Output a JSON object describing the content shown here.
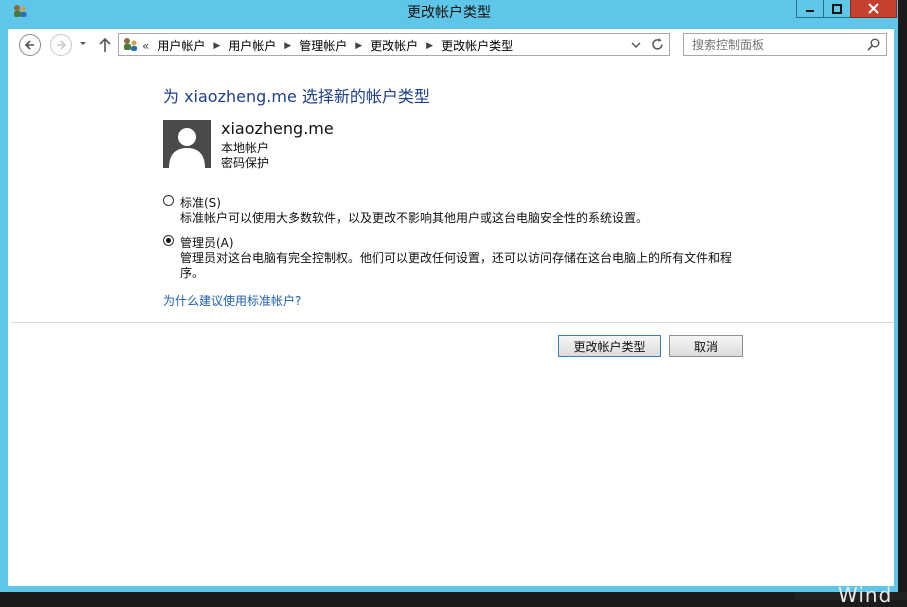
{
  "window": {
    "title": "更改帐户类型"
  },
  "address_bar": {
    "lead": "«",
    "crumbs": [
      "用户帐户",
      "用户帐户",
      "管理帐户",
      "更改帐户",
      "更改帐户类型"
    ]
  },
  "search": {
    "placeholder": "搜索控制面板"
  },
  "page": {
    "title": "为 xiaozheng.me 选择新的帐户类型"
  },
  "user": {
    "name": "xiaozheng.me",
    "account_type": "本地帐户",
    "password_status": "密码保护"
  },
  "options": [
    {
      "label": "标准(S)",
      "description": "标准帐户可以使用大多数软件，以及更改不影响其他用户或这台电脑安全性的系统设置。",
      "selected": false
    },
    {
      "label": "管理员(A)",
      "description": "管理员对这台电脑有完全控制权。他们可以更改任何设置，还可以访问存储在这台电脑上的所有文件和程序。",
      "selected": true
    }
  ],
  "help_link": "为什么建议使用标准帐户?",
  "buttons": {
    "change": "更改帐户类型",
    "cancel": "取消"
  },
  "taskbar": {
    "text": "Wind"
  },
  "colors": {
    "title_bar": "#5ec6e8",
    "heading": "#1e3f8f",
    "link": "#1e5fb4",
    "close_button": "#c7402f"
  }
}
